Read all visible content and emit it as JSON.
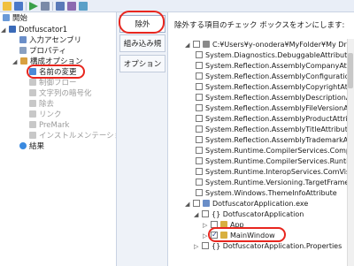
{
  "left_tree": {
    "start": "開始",
    "project": "Dotfuscator1",
    "input_assemblies": "入力アセンブリ",
    "properties": "プロパティ",
    "config_options": "構成オプション",
    "rename": "名前の変更",
    "control_flow": "制御フロー",
    "string_encryption": "文字列の暗号化",
    "removal": "除去",
    "linking": "リンク",
    "premark": "PreMark",
    "instrumentation": "インストルメンテーション",
    "results": "結果"
  },
  "mid_buttons": {
    "exclude": "除外",
    "builtin_rules": "組み込み規則",
    "options": "オプション"
  },
  "right": {
    "instruction": "除外する項目のチェック ボックスをオンにします:",
    "rows": [
      "C:¥Users¥y-onodera¥MyFolder¥My Dropbo",
      "System.Diagnostics.DebuggableAttribute",
      "System.Reflection.AssemblyCompanyAttrib",
      "System.Reflection.AssemblyConfigurationA",
      "System.Reflection.AssemblyCopyrightAttri",
      "System.Reflection.AssemblyDescriptionAtt",
      "System.Reflection.AssemblyFileVersionAttri",
      "System.Reflection.AssemblyProductAttribut",
      "System.Reflection.AssemblyTitleAttribute",
      "System.Reflection.AssemblyTrademarkAttri",
      "System.Runtime.CompilerServices.Compila",
      "System.Runtime.CompilerServices.Runtim",
      "System.Runtime.InteropServices.ComVisib",
      "System.Runtime.Versioning.TargetFramew",
      "System.Windows.ThemeInfoAttribute",
      "DotfuscatorApplication.exe",
      "{} DotfuscatorApplication",
      "App",
      "MainWindow",
      "{} DotfuscatorApplication.Properties"
    ]
  }
}
